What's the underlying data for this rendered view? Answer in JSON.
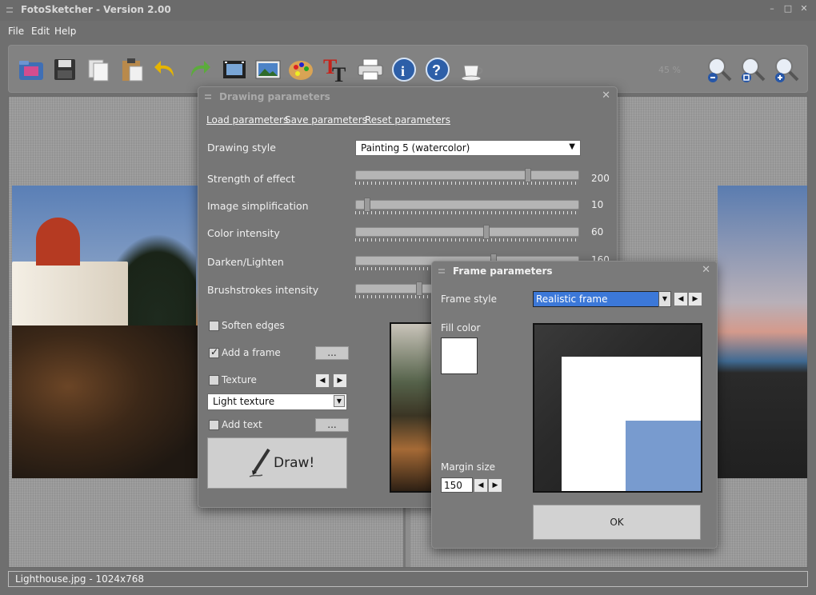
{
  "window": {
    "title": "FotoSketcher - Version 2.00",
    "controls": [
      "–",
      "□",
      "✕"
    ]
  },
  "menu": {
    "file": "File",
    "edit": "Edit",
    "help": "Help"
  },
  "toolbar": {
    "icons": [
      "open-icon",
      "save-icon",
      "copy-icon",
      "paste-icon",
      "undo-icon",
      "redo-icon",
      "film-icon",
      "image-icon",
      "palette-icon",
      "text-icon",
      "print-icon",
      "info-icon",
      "help-icon",
      "coffee-icon",
      "zoom-out-icon",
      "zoom-fit-icon",
      "zoom-in-icon"
    ],
    "zoom_percent": "45 %"
  },
  "drawing_dialog": {
    "title": "Drawing parameters",
    "links": {
      "load": "Load parameters",
      "save": "Save parameters",
      "reset": "Reset parameters"
    },
    "style_label": "Drawing style",
    "style_value": "Painting 5 (watercolor)",
    "params": [
      {
        "label": "Strength of effect",
        "value": "200",
        "level": 0.78
      },
      {
        "label": "Image simplification",
        "value": "10",
        "level": 0.04
      },
      {
        "label": "Color intensity",
        "value": "60",
        "level": 0.59
      },
      {
        "label": "Darken/Lighten",
        "value": "160",
        "level": 0.62
      },
      {
        "label": "Brushstrokes intensity",
        "value": "",
        "level": 0.28
      }
    ],
    "soften_edges": "Soften edges",
    "add_frame": "Add a frame",
    "texture": "Texture",
    "texture_value": "Light texture",
    "add_text": "Add text",
    "ellipsis": "...",
    "draw_button": "Draw!"
  },
  "frame_dialog": {
    "title": "Frame parameters",
    "style_label": "Frame style",
    "style_value": "Realistic frame",
    "fill_label": "Fill color",
    "fill_color": "#ffffff",
    "margin_label": "Margin size",
    "margin_value": "150",
    "ok": "OK"
  },
  "status": {
    "text": "Lighthouse.jpg - 1024x768"
  }
}
